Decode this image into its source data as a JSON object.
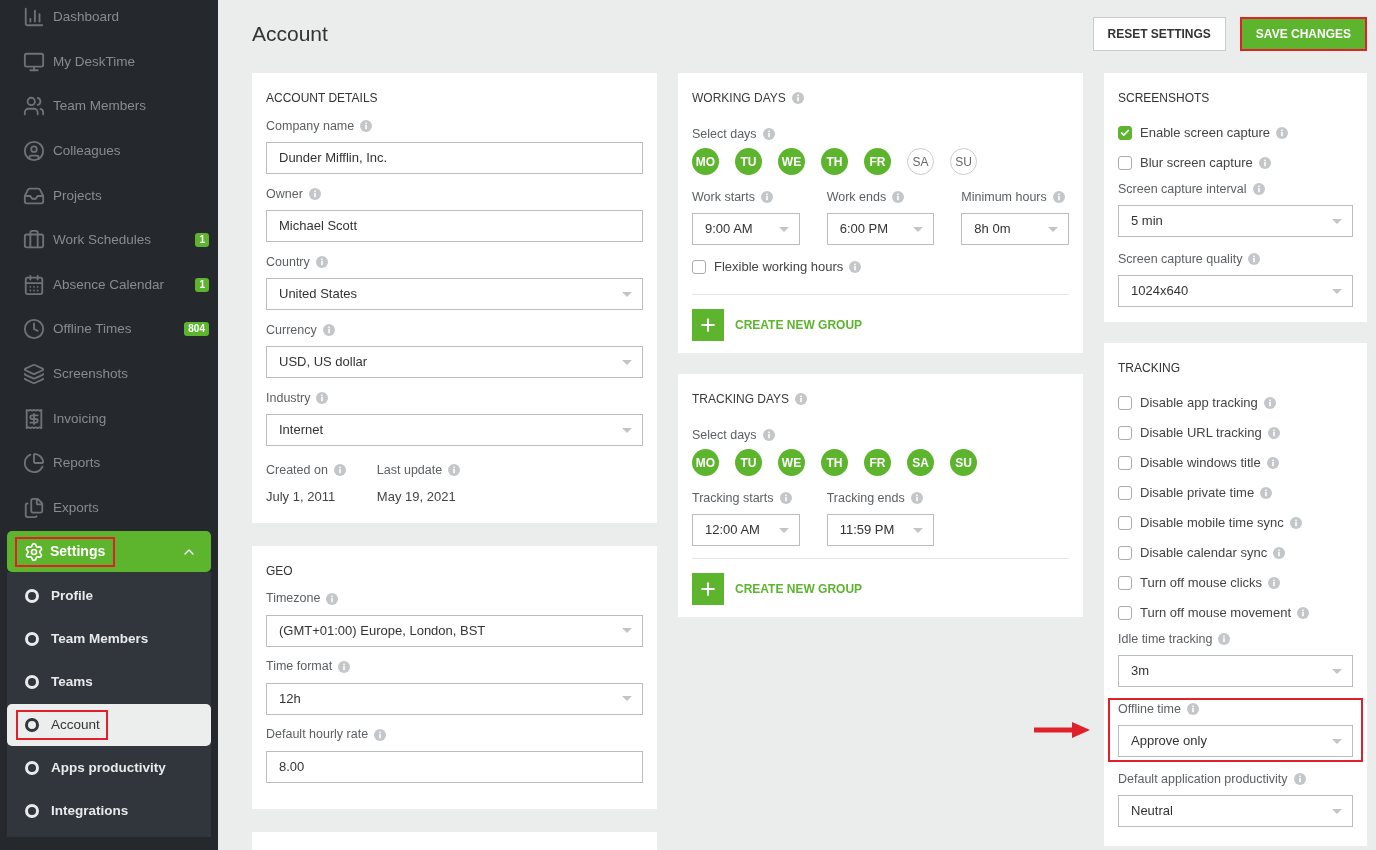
{
  "sidebar": {
    "items": [
      {
        "label": "Dashboard",
        "selected": false,
        "highlighted": false
      },
      {
        "label": "My DeskTime",
        "selected": false,
        "highlighted": false
      },
      {
        "label": "Team Members",
        "selected": false,
        "highlighted": false
      },
      {
        "label": "Colleagues",
        "selected": false,
        "highlighted": false
      },
      {
        "label": "Projects",
        "selected": false,
        "highlighted": false
      },
      {
        "label": "Work Schedules",
        "badge": "1",
        "selected": false,
        "highlighted": false
      },
      {
        "label": "Absence Calendar",
        "badge": "1",
        "selected": false,
        "highlighted": false
      },
      {
        "label": "Offline Times",
        "badge": "804",
        "selected": false,
        "highlighted": false
      },
      {
        "label": "Screenshots",
        "selected": false,
        "highlighted": false
      },
      {
        "label": "Invoicing",
        "selected": false,
        "highlighted": false
      },
      {
        "label": "Reports",
        "selected": false,
        "highlighted": false
      },
      {
        "label": "Exports",
        "selected": false,
        "highlighted": false
      },
      {
        "label": "Settings",
        "selected": true,
        "expanded": true,
        "highlighted": true,
        "children": [
          {
            "label": "Profile",
            "selected": false,
            "highlighted": false
          },
          {
            "label": "Team Members",
            "selected": false,
            "highlighted": false
          },
          {
            "label": "Teams",
            "selected": false,
            "highlighted": false
          },
          {
            "label": "Account",
            "selected": true,
            "highlighted": true
          },
          {
            "label": "Apps productivity",
            "selected": false,
            "highlighted": false
          },
          {
            "label": "Integrations",
            "selected": false,
            "highlighted": false
          }
        ]
      }
    ]
  },
  "page": {
    "title": "Account",
    "buttons": [
      {
        "label": "RESET SETTINGS",
        "kind": "secondary",
        "highlighted": false
      },
      {
        "label": "SAVE CHANGES",
        "kind": "primary",
        "highlighted": true
      }
    ]
  },
  "account_details": {
    "title": "ACCOUNT DETAILS",
    "info": false,
    "fields": [
      {
        "label": "Company name",
        "kind": "text",
        "value": "Dunder Mifflin, Inc."
      },
      {
        "label": "Owner",
        "kind": "text",
        "value": "Michael Scott"
      },
      {
        "label": "Country",
        "kind": "select",
        "value": "United States"
      },
      {
        "label": "Currency",
        "kind": "select",
        "value": "USD, US dollar"
      },
      {
        "label": "Industry",
        "kind": "select",
        "value": "Internet"
      }
    ],
    "dates": [
      {
        "label": "Created on",
        "value": "July 1, 2011"
      },
      {
        "label": "Last update",
        "value": "May 19, 2021"
      }
    ]
  },
  "geo": {
    "title": "GEO",
    "info": false,
    "fields": [
      {
        "label": "Timezone",
        "kind": "select",
        "value": "(GMT+01:00) Europe, London, BST"
      },
      {
        "label": "Time format",
        "kind": "select",
        "value": "12h"
      },
      {
        "label": "Default hourly rate",
        "kind": "text",
        "value": "8.00"
      }
    ]
  },
  "working_days": {
    "title": "WORKING DAYS",
    "info": true,
    "days_label": "Select days",
    "days": [
      {
        "label": "MO",
        "selected": true
      },
      {
        "label": "TU",
        "selected": true
      },
      {
        "label": "WE",
        "selected": true
      },
      {
        "label": "TH",
        "selected": true
      },
      {
        "label": "FR",
        "selected": true
      },
      {
        "label": "SA",
        "selected": false
      },
      {
        "label": "SU",
        "selected": false
      }
    ],
    "times": [
      {
        "label": "Work starts",
        "value": "9:00 AM"
      },
      {
        "label": "Work ends",
        "value": "6:00 PM"
      },
      {
        "label": "Minimum hours",
        "value": "8h 0m"
      }
    ],
    "checks": [
      {
        "label": "Flexible working hours",
        "checked": false
      }
    ],
    "create_button": "CREATE NEW GROUP"
  },
  "tracking_days": {
    "title": "TRACKING DAYS",
    "info": true,
    "days_label": "Select days",
    "days": [
      {
        "label": "MO",
        "selected": true
      },
      {
        "label": "TU",
        "selected": true
      },
      {
        "label": "WE",
        "selected": true
      },
      {
        "label": "TH",
        "selected": true
      },
      {
        "label": "FR",
        "selected": true
      },
      {
        "label": "SA",
        "selected": true
      },
      {
        "label": "SU",
        "selected": true
      }
    ],
    "times": [
      {
        "label": "Tracking starts",
        "value": "12:00 AM"
      },
      {
        "label": "Tracking ends",
        "value": "11:59 PM"
      }
    ],
    "create_button": "CREATE NEW GROUP"
  },
  "screenshots": {
    "title": "SCREENSHOTS",
    "info": false,
    "checks": [
      {
        "label": "Enable screen capture",
        "checked": true
      },
      {
        "label": "Blur screen capture",
        "checked": false
      }
    ],
    "fields": [
      {
        "label": "Screen capture interval",
        "value": "5 min",
        "highlighted": false
      },
      {
        "label": "Screen capture quality",
        "value": "1024x640",
        "highlighted": false
      }
    ]
  },
  "tracking": {
    "title": "TRACKING",
    "info": false,
    "checks": [
      {
        "label": "Disable app tracking",
        "checked": false
      },
      {
        "label": "Disable URL tracking",
        "checked": false
      },
      {
        "label": "Disable windows title",
        "checked": false
      },
      {
        "label": "Disable private time",
        "checked": false
      },
      {
        "label": "Disable mobile time sync",
        "checked": false
      },
      {
        "label": "Disable calendar sync",
        "checked": false
      },
      {
        "label": "Turn off mouse clicks",
        "checked": false
      },
      {
        "label": "Turn off mouse movement",
        "checked": false
      }
    ],
    "fields": [
      {
        "label": "Idle time tracking",
        "value": "3m",
        "highlighted": false
      },
      {
        "label": "Offline time",
        "value": "Approve only",
        "highlighted": true
      },
      {
        "label": "Default application productivity",
        "value": "Neutral",
        "highlighted": false
      }
    ]
  }
}
